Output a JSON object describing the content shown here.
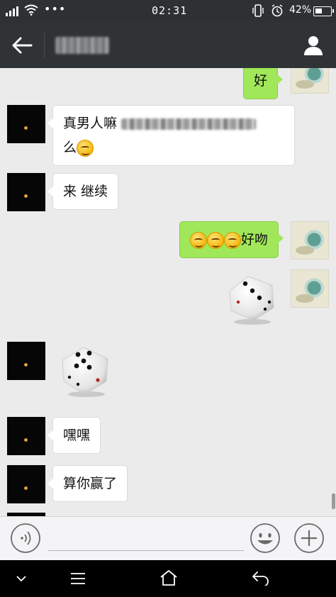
{
  "status_bar": {
    "time": "02:31",
    "battery": "42%",
    "more": "•••"
  },
  "header": {
    "title": "",
    "back_icon": "back-arrow-icon",
    "contact_icon": "person-icon"
  },
  "messages": [
    {
      "side": "right",
      "type": "text",
      "text": "好"
    },
    {
      "side": "left",
      "type": "text",
      "text": "真男人嘛",
      "text_tail": "么",
      "emoji": "grinning-face-icon"
    },
    {
      "side": "left",
      "type": "text",
      "text": "来 继续"
    },
    {
      "side": "right",
      "type": "text",
      "text": "好吻",
      "emoji": "smirking-face-icon"
    },
    {
      "side": "right",
      "type": "dice",
      "value": 3
    },
    {
      "side": "left",
      "type": "dice",
      "value": 5
    },
    {
      "side": "left",
      "type": "text",
      "text": "嘿嘿"
    },
    {
      "side": "left",
      "type": "text",
      "text": "算你赢了"
    }
  ],
  "input_bar": {
    "placeholder": "",
    "voice_icon": "voice-icon",
    "emoji_icon": "emoji-icon",
    "plus_icon": "plus-icon"
  },
  "nav_bar": {
    "icons": [
      "chevron-down-icon",
      "menu-icon",
      "home-icon",
      "back-icon"
    ]
  },
  "colors": {
    "status_bar": "#2e3132",
    "header": "#303336",
    "chat_bg": "#ebebeb",
    "green_bubble": "#a0e75a",
    "white_bubble": "#ffffff"
  }
}
